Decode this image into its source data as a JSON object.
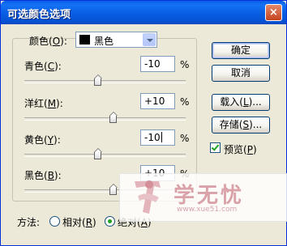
{
  "window": {
    "title": "可选颜色选项",
    "close_glyph": "×"
  },
  "colors_select": {
    "label": "颜色(",
    "key": "O",
    "label_end": "):",
    "value": "黑色",
    "swatch_color": "#000000"
  },
  "sliders": [
    {
      "label": "青色(",
      "key": "C",
      "label_end": "):",
      "value": "-10",
      "unit": "%",
      "level_percent": -10
    },
    {
      "label": "洋红(",
      "key": "M",
      "label_end": "):",
      "value": "+10",
      "unit": "%",
      "level_percent": 10
    },
    {
      "label": "黄色(",
      "key": "Y",
      "label_end": "):",
      "value": "-10",
      "unit": "%",
      "level_percent": -10
    },
    {
      "label": "黑色(",
      "key": "B",
      "label_end": "):",
      "value": "+10",
      "unit": "%",
      "level_percent": 10
    }
  ],
  "buttons": {
    "ok": "确定",
    "cancel": "取消",
    "load": "载入(",
    "load_key": "L",
    "load_end": ")...",
    "save": "存储(",
    "save_key": "S",
    "save_end": ")..."
  },
  "preview": {
    "label": "预览(",
    "key": "P",
    "label_end": ")",
    "checked": true
  },
  "method": {
    "label": "方法:",
    "relative": "相对(",
    "relative_key": "R",
    "relative_end": ")",
    "absolute": "绝对(",
    "absolute_key": "A",
    "absolute_end": ")",
    "selected": "absolute"
  },
  "watermark": {
    "text": "学无忧",
    "url": "www.xue51.com"
  }
}
